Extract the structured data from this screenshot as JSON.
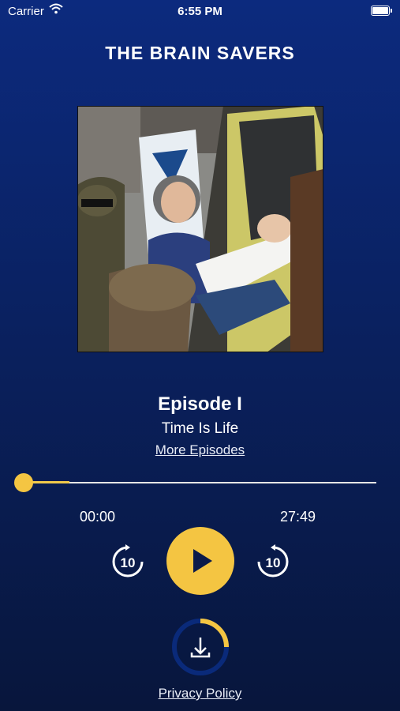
{
  "status_bar": {
    "carrier": "Carrier",
    "time": "6:55 PM"
  },
  "app": {
    "title": "THE BRAIN SAVERS"
  },
  "episode": {
    "title": "Episode I",
    "subtitle": "Time Is Life",
    "more_link": "More Episodes"
  },
  "player": {
    "elapsed": "00:00",
    "duration": "27:49",
    "progress_fraction": 0.0,
    "buffered_fraction": 0.13,
    "skip_back_seconds": "10",
    "skip_forward_seconds": "10",
    "state": "paused"
  },
  "download": {
    "progress_fraction": 0.25
  },
  "footer": {
    "privacy_link": "Privacy Policy"
  },
  "colors": {
    "accent": "#f4c542",
    "background_top": "#0c2a7e",
    "background_bottom": "#08163c"
  },
  "icons": {
    "wifi": "wifi-icon",
    "battery": "battery-icon",
    "play": "play-icon",
    "skip_back": "rewind-10-icon",
    "skip_forward": "forward-10-icon",
    "download": "download-icon"
  }
}
